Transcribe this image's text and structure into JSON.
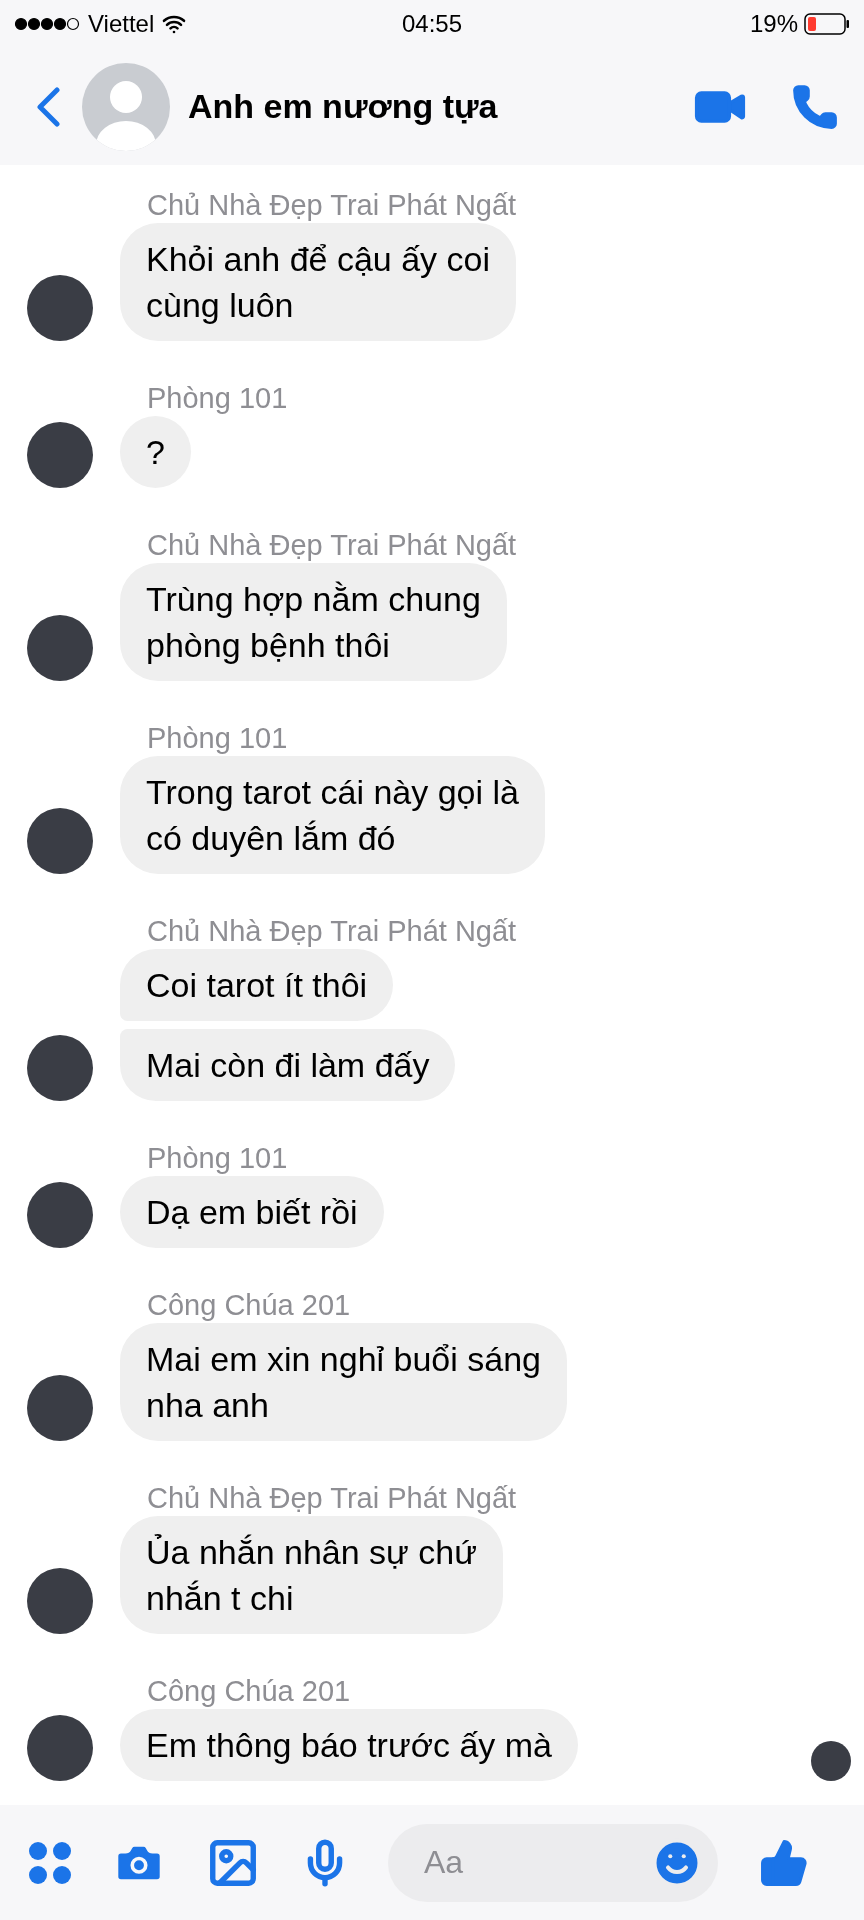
{
  "status_bar": {
    "carrier": "Viettel",
    "time": "04:55",
    "battery": "19%"
  },
  "header": {
    "title": "Anh em nương tựa"
  },
  "groups": [
    {
      "sender": "Chủ Nhà Đẹp Trai Phát Ngất",
      "messages": [
        "Khỏi anh để cậu ấy coi\ncùng luôn"
      ]
    },
    {
      "sender": "Phòng 101",
      "messages": [
        "?"
      ]
    },
    {
      "sender": "Chủ Nhà Đẹp Trai Phát Ngất",
      "messages": [
        "Trùng hợp nằm chung\nphòng bệnh thôi"
      ]
    },
    {
      "sender": "Phòng 101",
      "messages": [
        "Trong tarot cái này gọi là\ncó duyên lắm đó"
      ]
    },
    {
      "sender": "Chủ Nhà Đẹp Trai Phát Ngất",
      "messages": [
        "Coi tarot ít thôi",
        "Mai còn đi làm đấy"
      ]
    },
    {
      "sender": "Phòng 101",
      "messages": [
        "Dạ em biết rồi"
      ]
    },
    {
      "sender": "Công Chúa 201",
      "messages": [
        "Mai em xin nghỉ buổi sáng\nnha anh"
      ]
    },
    {
      "sender": "Chủ Nhà Đẹp Trai Phát Ngất",
      "messages": [
        "Ủa nhắn nhân sự chứ\nnhắn t chi"
      ]
    },
    {
      "sender": "Công Chúa 201",
      "messages": [
        "Em thông báo trước ấy mà"
      ],
      "seen": true
    }
  ],
  "composer": {
    "placeholder": "Aa"
  }
}
